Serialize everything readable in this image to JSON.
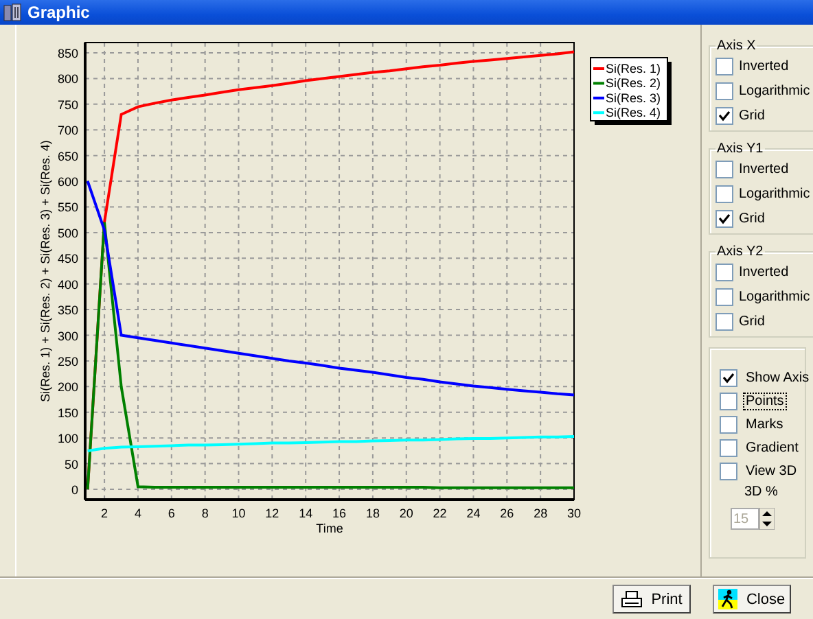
{
  "window": {
    "title": "Graphic"
  },
  "chart": {
    "chart_data": {
      "type": "line",
      "grid": true,
      "legend": true,
      "xlabel": "Time",
      "ylabel": "Si(Res. 1) + Si(Res. 2) + Si(Res. 3) + Si(Res. 4)",
      "x": [
        1,
        2,
        3,
        4,
        5,
        6,
        7,
        8,
        9,
        10,
        11,
        12,
        13,
        14,
        15,
        16,
        17,
        18,
        19,
        20,
        21,
        22,
        23,
        24,
        25,
        26,
        27,
        28,
        29,
        30
      ],
      "xlim": [
        0.85,
        30
      ],
      "ylim": [
        -20,
        870
      ],
      "xticks": [
        2,
        4,
        6,
        8,
        10,
        12,
        14,
        16,
        18,
        20,
        22,
        24,
        26,
        28,
        30
      ],
      "yticks": [
        0,
        50,
        100,
        150,
        200,
        250,
        300,
        350,
        400,
        450,
        500,
        550,
        600,
        650,
        700,
        750,
        800,
        850
      ],
      "series": [
        {
          "name": "Si(Res. 1)",
          "color": "#ff0000",
          "values": [
            0,
            520,
            730,
            745,
            752,
            758,
            763,
            768,
            773,
            778,
            782,
            786,
            791,
            796,
            800,
            804,
            808,
            812,
            815,
            819,
            823,
            826,
            830,
            833,
            836,
            839,
            842,
            845,
            848,
            852
          ]
        },
        {
          "name": "Si(Res. 2)",
          "color": "#008000",
          "values": [
            0,
            520,
            200,
            5,
            4,
            4,
            4,
            4,
            4,
            4,
            4,
            4,
            4,
            4,
            4,
            4,
            4,
            4,
            4,
            4,
            4,
            3,
            3,
            3,
            3,
            3,
            3,
            3,
            3,
            3
          ]
        },
        {
          "name": "Si(Res. 3)",
          "color": "#0000ff",
          "values": [
            600,
            505,
            300,
            295,
            290,
            285,
            280,
            275,
            270,
            265,
            260,
            255,
            250,
            246,
            241,
            236,
            232,
            228,
            223,
            218,
            214,
            209,
            205,
            201,
            198,
            195,
            192,
            189,
            186,
            184
          ]
        },
        {
          "name": "Si(Res. 4)",
          "color": "#00ffff",
          "values": [
            75,
            80,
            82,
            83,
            84,
            85,
            86,
            86,
            87,
            88,
            89,
            90,
            90,
            91,
            92,
            93,
            93,
            94,
            95,
            96,
            96,
            97,
            98,
            99,
            99,
            100,
            101,
            102,
            102,
            103
          ]
        }
      ]
    }
  },
  "axis_groups": [
    {
      "title": "Axis X",
      "options": [
        {
          "label": "Inverted",
          "checked": false
        },
        {
          "label": "Logarithmic",
          "checked": false
        },
        {
          "label": "Grid",
          "checked": true
        }
      ]
    },
    {
      "title": "Axis Y1",
      "options": [
        {
          "label": "Inverted",
          "checked": false
        },
        {
          "label": "Logarithmic",
          "checked": false
        },
        {
          "label": "Grid",
          "checked": true
        }
      ]
    },
    {
      "title": "Axis Y2",
      "options": [
        {
          "label": "Inverted",
          "checked": false
        },
        {
          "label": "Logarithmic",
          "checked": false
        },
        {
          "label": "Grid",
          "checked": false
        }
      ]
    }
  ],
  "display_options": [
    {
      "label": "Show Axis",
      "checked": true,
      "focused": false
    },
    {
      "label": "Points",
      "checked": false,
      "focused": true
    },
    {
      "label": "Marks",
      "checked": false,
      "focused": false
    },
    {
      "label": "Gradient",
      "checked": false,
      "focused": false
    },
    {
      "label": "View 3D",
      "checked": false,
      "focused": false
    }
  ],
  "view_3d_percent": {
    "label": "3D %",
    "value": "15",
    "disabled": true
  },
  "buttons": [
    {
      "label": "Print",
      "kind": "print"
    },
    {
      "label": "Close",
      "kind": "close"
    }
  ]
}
